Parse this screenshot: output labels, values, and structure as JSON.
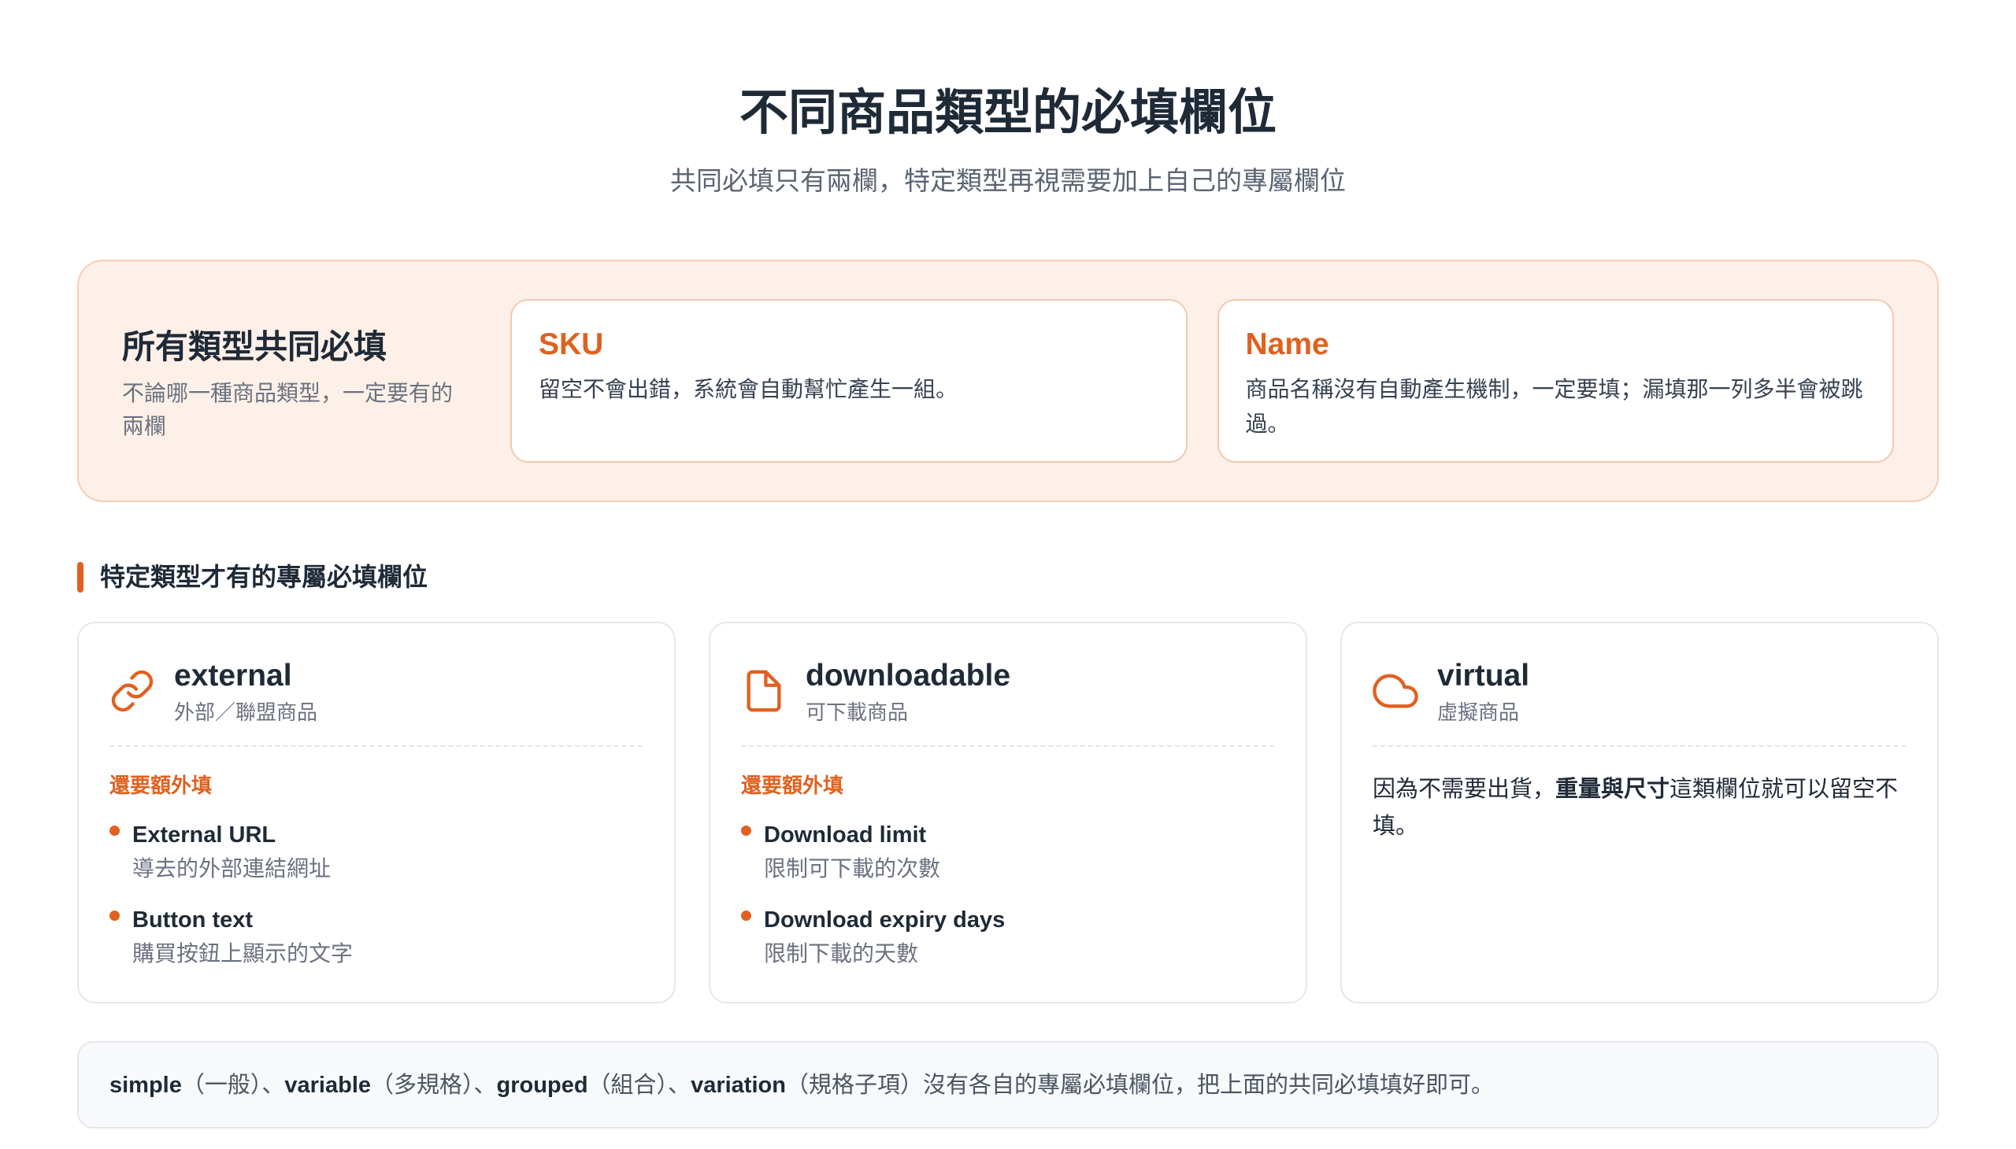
{
  "header": {
    "title": "不同商品類型的必填欄位",
    "subtitle": "共同必填只有兩欄，特定類型再視需要加上自己的專屬欄位"
  },
  "common": {
    "heading": "所有類型共同必填",
    "description": "不論哪一種商品類型，一定要有的兩欄",
    "fields": [
      {
        "name": "SKU",
        "description": "留空不會出錯，系統會自動幫忙產生一組。"
      },
      {
        "name": "Name",
        "description": "商品名稱沒有自動產生機制，一定要填；漏填那一列多半會被跳過。"
      }
    ]
  },
  "specific": {
    "heading": "特定類型才有的專屬必填欄位",
    "types": [
      {
        "name": "external",
        "label": "外部／聯盟商品",
        "icon": "link-icon",
        "extra_label": "還要額外填",
        "fields": [
          {
            "name": "External URL",
            "description": "導去的外部連結網址"
          },
          {
            "name": "Button text",
            "description": "購買按鈕上顯示的文字"
          }
        ]
      },
      {
        "name": "downloadable",
        "label": "可下載商品",
        "icon": "file-icon",
        "extra_label": "還要額外填",
        "fields": [
          {
            "name": "Download limit",
            "description": "限制可下載的次數"
          },
          {
            "name": "Download expiry days",
            "description": "限制下載的天數"
          }
        ]
      },
      {
        "name": "virtual",
        "label": "虛擬商品",
        "icon": "cloud-icon",
        "note_parts": [
          "因為不需要出貨，",
          "重量與尺寸",
          "這類欄位就可以留空不填。"
        ]
      }
    ]
  },
  "footer_note": {
    "parts": [
      "simple",
      "（一般）、",
      "variable",
      "（多規格）、",
      "grouped",
      "（組合）、",
      "variation",
      "（規格子項）沒有各自的專屬必填欄位，把上面的共同必填填好即可。"
    ]
  },
  "colors": {
    "accent": "#e0611f",
    "panel_background": "#fdf0e8",
    "panel_border": "#f7cdb6",
    "text_primary": "#1f2a37",
    "text_muted": "#6b7280",
    "note_background": "#f8f9fb"
  }
}
